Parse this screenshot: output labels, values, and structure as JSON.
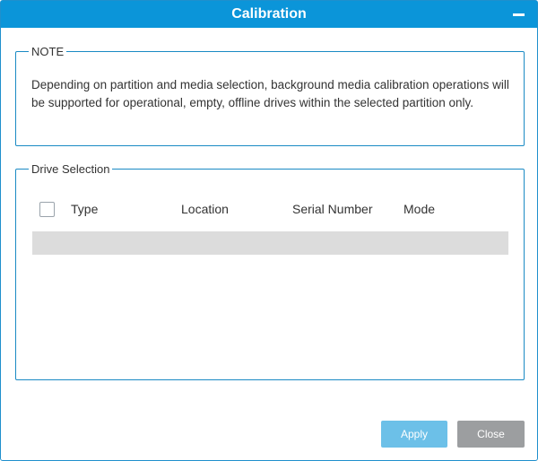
{
  "dialog": {
    "title": "Calibration"
  },
  "note": {
    "legend": "NOTE",
    "text": "Depending on partition and media selection, background media calibration operations will be supported for operational, empty, offline drives within the selected partition only."
  },
  "drive_selection": {
    "legend": "Drive Selection",
    "columns": [
      "Type",
      "Location",
      "Serial Number",
      "Mode"
    ],
    "select_all_checked": false,
    "rows": []
  },
  "buttons": {
    "apply_label": "Apply",
    "close_label": "Close"
  },
  "colors": {
    "titlebar": "#0b95d9",
    "border": "#1a8ac4",
    "apply": "#6cc0e8",
    "close": "#9c9ea0",
    "empty_row": "#dcdcdc"
  },
  "icons": {
    "minimize": "minimize-icon"
  }
}
